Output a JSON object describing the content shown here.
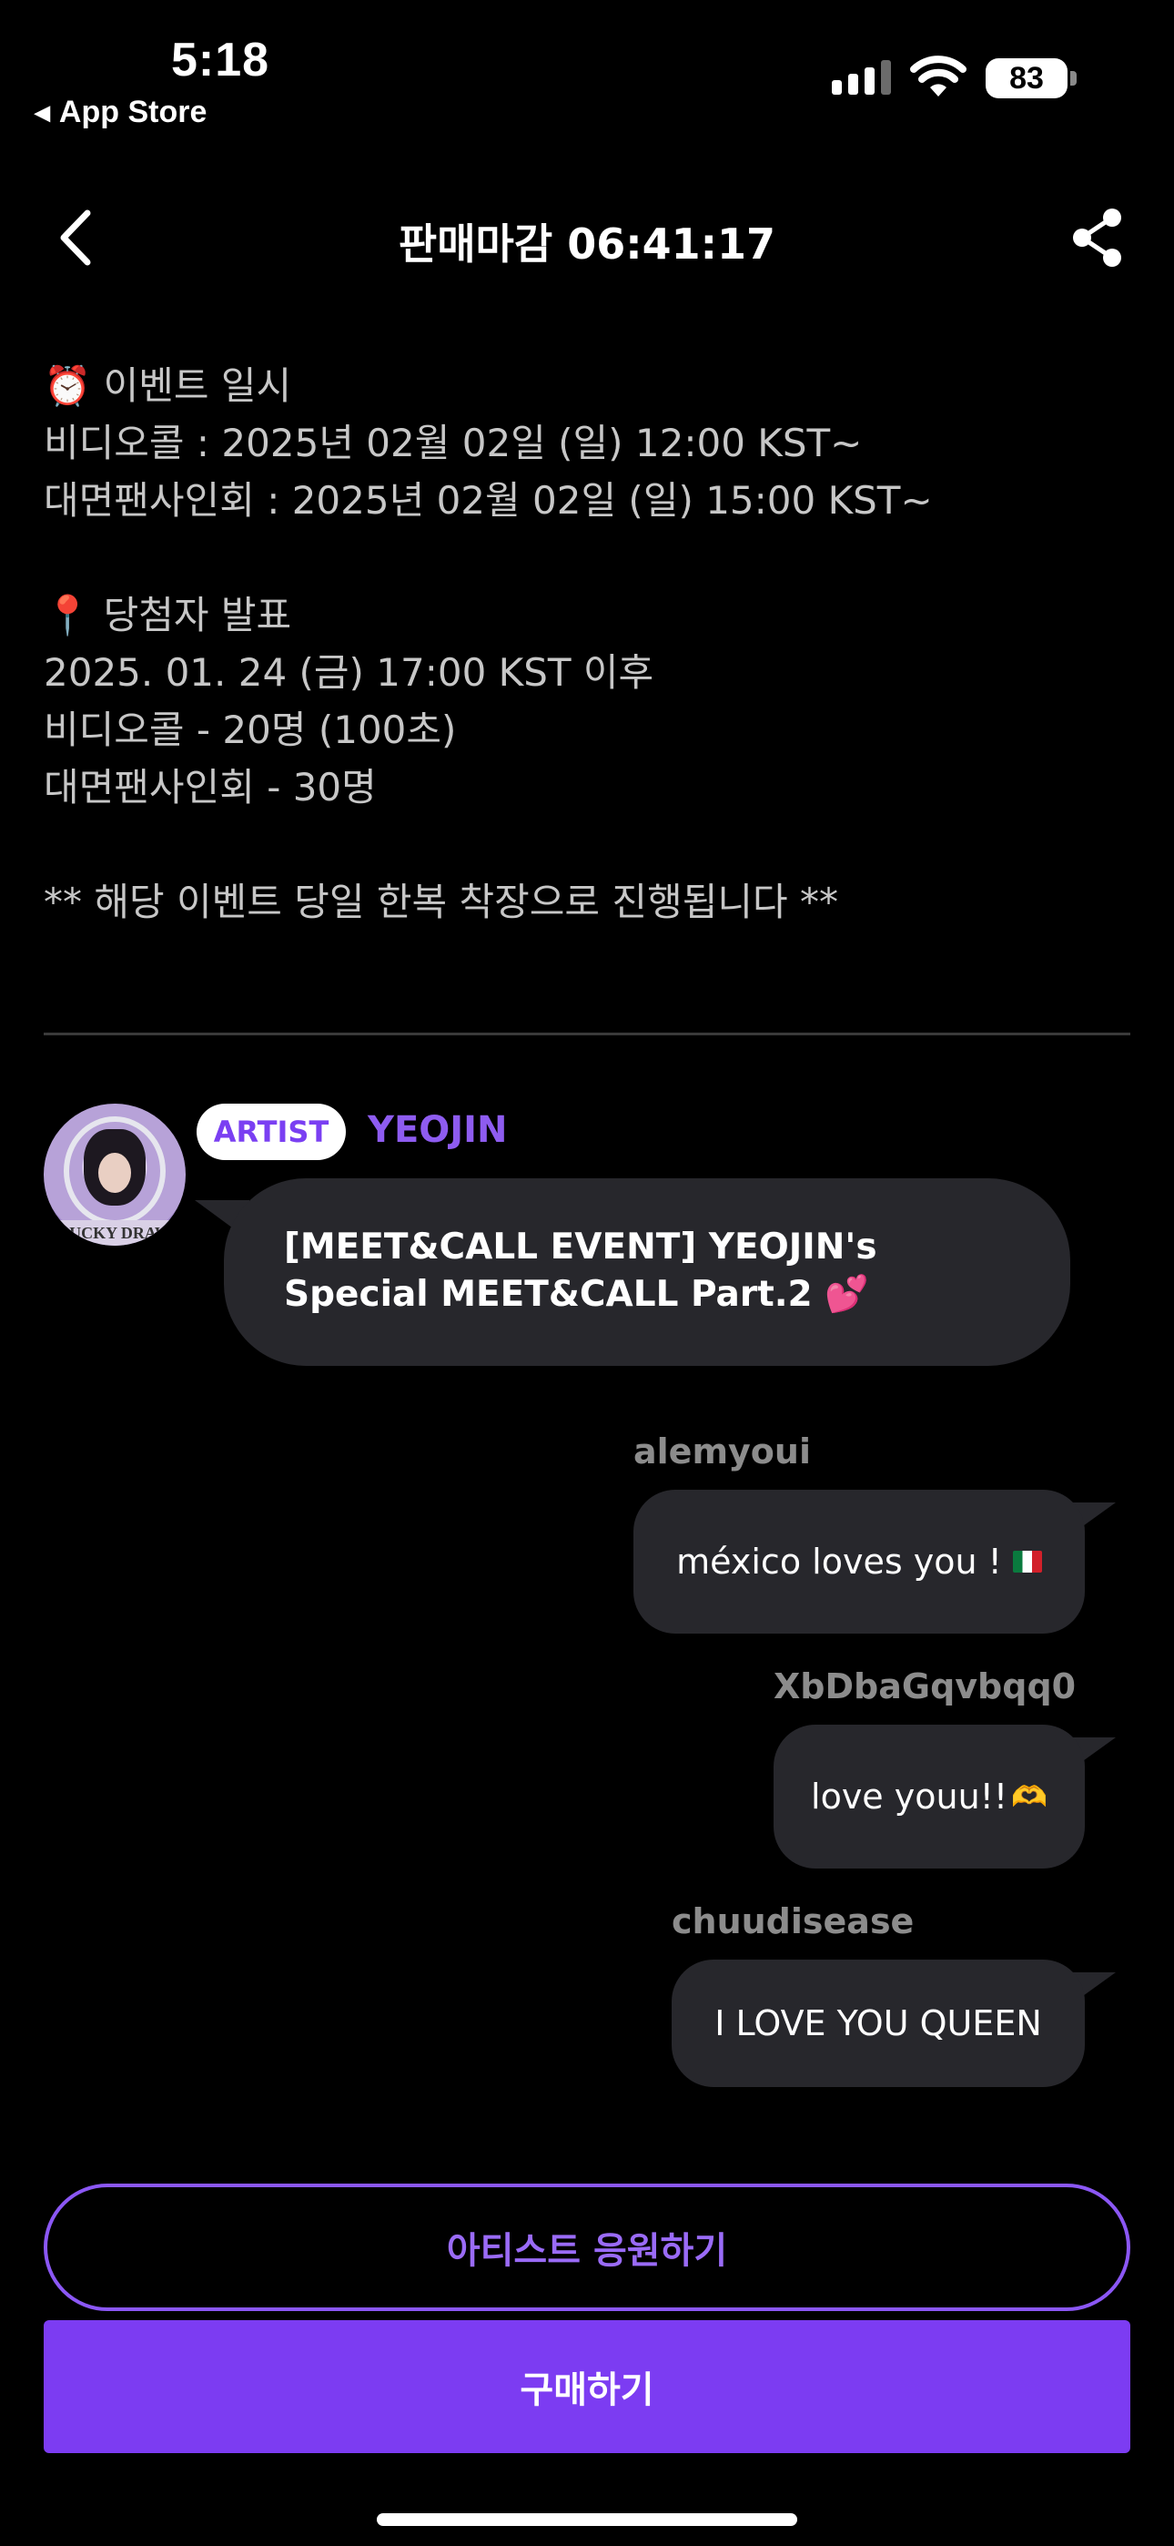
{
  "status_bar": {
    "time": "5:18",
    "back_app": "App Store",
    "battery": "83"
  },
  "nav": {
    "title": "판매마감 06:41:17"
  },
  "description": {
    "lines": [
      "⏰ 이벤트 일시",
      "비디오콜 : 2025년 02월 02일 (일) 12:00 KST~",
      "대면팬사인회 : 2025년 02월 02일 (일) 15:00 KST~",
      "",
      "📍 당첨자 발표",
      "2025. 01. 24 (금) 17:00 KST 이후",
      "비디오콜 - 20명 (100초)",
      "대면팬사인회 - 30명",
      "",
      "** 해당 이벤트 당일 한복 착장으로 진행됩니다 **"
    ]
  },
  "artist_message": {
    "badge": "ARTIST",
    "name": "YEOJIN",
    "avatar_text": "LUCKY DRAW",
    "text": "[MEET&CALL EVENT] YEOJIN's Special MEET&CALL Part.2 💕"
  },
  "fan_messages": [
    {
      "user": "alemyoui",
      "text": "méxico loves you !",
      "emoji": "flag-mexico"
    },
    {
      "user": "XbDbaGqvbqq0",
      "text": "love youu!!",
      "emoji": "heart-hands"
    },
    {
      "user": "chuudisease",
      "text": "I LOVE YOU QUEEN"
    }
  ],
  "buttons": {
    "support": "아티스트 응원하기",
    "buy": "구매하기"
  },
  "colors": {
    "accent": "#7c3cf2",
    "accent_text": "#8e5cf0",
    "bubble": "#27272c",
    "background": "#000000"
  }
}
